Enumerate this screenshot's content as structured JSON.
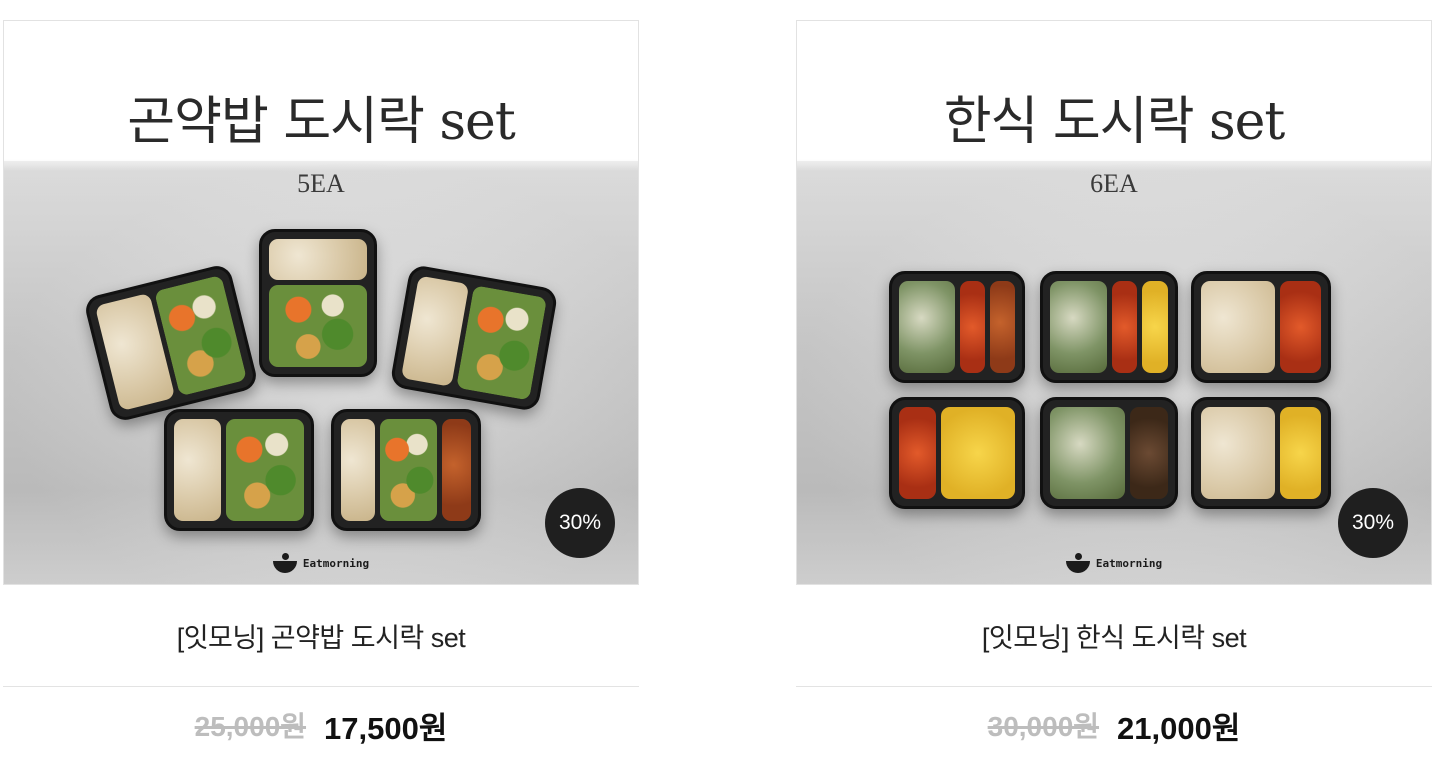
{
  "products": [
    {
      "image_title": "곤약밥 도시락 set",
      "image_qty": "5EA",
      "badge": "30%",
      "brand": "Eatmorning",
      "name": "[잇모닝] 곤약밥 도시락 set",
      "original_price": "25,000원",
      "sale_price": "17,500원"
    },
    {
      "image_title": "한식 도시락 set",
      "image_qty": "6EA",
      "badge": "30%",
      "brand": "Eatmorning",
      "name": "[잇모닝] 한식 도시락 set",
      "original_price": "30,000원",
      "sale_price": "21,000원"
    }
  ],
  "colors": {
    "badge_bg": "#1f1f1f",
    "sale_price": "#111111",
    "original_price": "#bdbdbd"
  }
}
